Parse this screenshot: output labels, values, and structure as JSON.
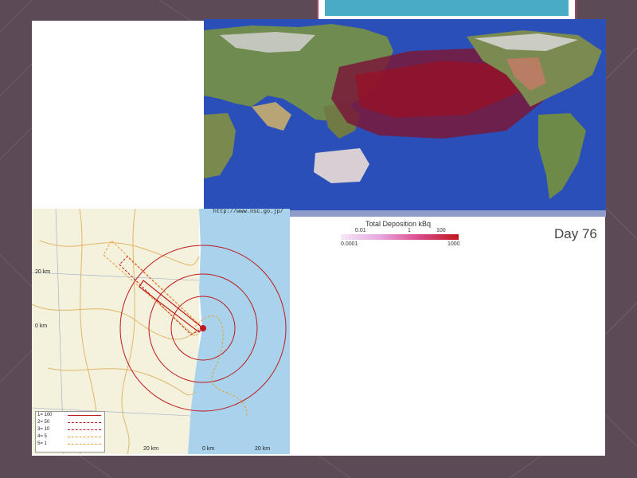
{
  "world_map": {
    "legend": {
      "title": "Total Deposition kBq",
      "ticks_top": [
        "0.01",
        "1",
        "100"
      ],
      "ticks_bottom": [
        "0.0001",
        "1000"
      ]
    },
    "day_label": "Day 76"
  },
  "local_map": {
    "source_url": "http://www.nsc.go.jp/",
    "distance_labels": [
      "20 km",
      "0 km",
      "20 km",
      "0 km",
      "20 km"
    ],
    "legend_rows": [
      {
        "label": "1= 100",
        "color": "#c0181e",
        "style": "solid"
      },
      {
        "label": "2= 50",
        "color": "#c0181e",
        "style": "dashed"
      },
      {
        "label": "3= 10",
        "color": "#c0181e",
        "style": "dashed"
      },
      {
        "label": "4= 5",
        "color": "#e8a030",
        "style": "dashed"
      },
      {
        "label": "5= 1",
        "color": "#e8a030",
        "style": "dashed"
      }
    ]
  }
}
